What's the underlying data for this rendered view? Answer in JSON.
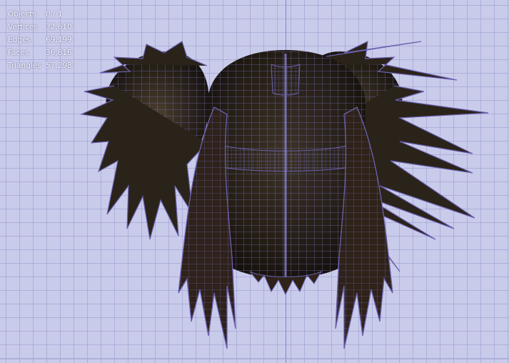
{
  "stats": {
    "objects": {
      "label": "Objects",
      "value": "0 / 1"
    },
    "vertices": {
      "label": "Vertices",
      "value": "32,610"
    },
    "edges": {
      "label": "Edges",
      "value": "69,199"
    },
    "faces": {
      "label": "Faces",
      "value": "36,616"
    },
    "triangles": {
      "label": "Triangles",
      "value": "57,298"
    }
  },
  "colors": {
    "background": "#c9cbea",
    "wire": "#6a61b0",
    "mesh_dark": "#2a2319"
  }
}
